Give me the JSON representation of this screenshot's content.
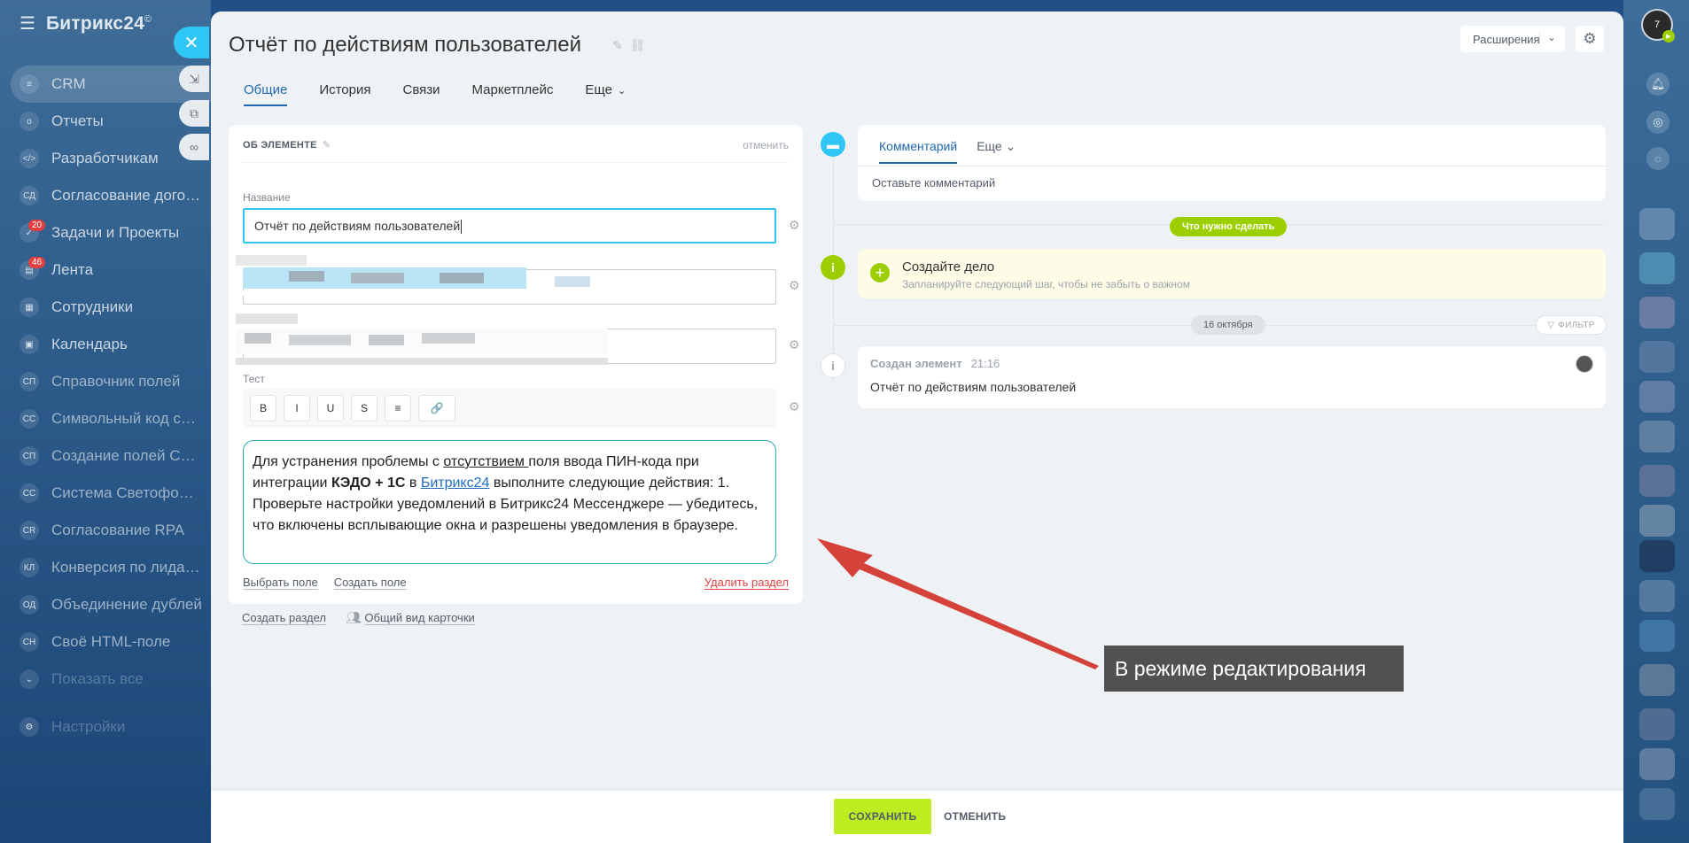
{
  "sidebar": {
    "brand": "Битрикс24",
    "brand_mark": "©",
    "items": [
      {
        "label": "CRM",
        "badge": ""
      },
      {
        "label": "Отчеты",
        "badge": ""
      },
      {
        "label": "Разработчикам",
        "badge": ""
      },
      {
        "label": "Согласование договора",
        "badge": ""
      },
      {
        "label": "Задачи и Проекты",
        "badge": "20"
      },
      {
        "label": "Лента",
        "badge": "46"
      },
      {
        "label": "Сотрудники",
        "badge": ""
      },
      {
        "label": "Календарь",
        "badge": ""
      },
      {
        "label": "Справочник полей",
        "badge": ""
      },
      {
        "label": "Символьный код спра...",
        "badge": ""
      },
      {
        "label": "Создание полей CRM",
        "badge": ""
      },
      {
        "label": "Система Светофор CRM",
        "badge": ""
      },
      {
        "label": "Согласование RPA",
        "badge": ""
      },
      {
        "label": "Конверсия по лидам ...",
        "badge": ""
      },
      {
        "label": "Объединение дублей",
        "badge": ""
      },
      {
        "label": "Своё HTML-поле",
        "badge": ""
      },
      {
        "label": "Показать все",
        "badge": ""
      },
      {
        "label": "Настройки",
        "badge": ""
      }
    ]
  },
  "header": {
    "title": "Отчёт по действиям пользователей",
    "extensions_label": "Расширения"
  },
  "tabs": [
    {
      "label": "Общие"
    },
    {
      "label": "История"
    },
    {
      "label": "Связи"
    },
    {
      "label": "Маркетплейс"
    },
    {
      "label": "Еще"
    }
  ],
  "card": {
    "section_title": "ОБ ЭЛЕМЕНТЕ",
    "cancel_label": "отменить",
    "name_label": "Название",
    "name_value": "Отчёт по действиям пользователей",
    "test_label": "Тест",
    "toolbar": [
      "B",
      "I",
      "U",
      "S",
      "≡",
      "🔗"
    ],
    "text": {
      "p1": "Для устранения проблемы с ",
      "p2": "отсутствием ",
      "p3": "поля ввода ПИН-кода при интеграции ",
      "p4": "КЭДО + 1С",
      "p5": " в ",
      "p6": "Битрикс24",
      "p7": " выполните следующие действия: 1. Проверьте настройки уведомлений в Битрикс24 Мессенджере — убедитесь, что включены всплывающие окна и разрешены уведомления в браузере."
    },
    "choose_field": "Выбрать поле",
    "create_field": "Создать поле",
    "delete_section": "Удалить раздел"
  },
  "below_card": {
    "create_section": "Создать раздел",
    "card_view": "Общий вид карточки"
  },
  "timeline": {
    "comment_tab": "Комментарий",
    "more_tab": "Еще",
    "comment_placeholder": "Оставьте комментарий",
    "todo_pill": "Что нужно сделать",
    "todo_title": "Создайте дело",
    "todo_sub": "Запланируйте следующий шаг, чтобы не забыть о важном",
    "date_pill": "16 октября",
    "filter_label": "ФИЛЬТР",
    "created_title": "Создан элемент",
    "created_time": "21:16",
    "created_text": "Отчёт по действиям пользователей"
  },
  "annotation": "В режиме редактирования",
  "footer": {
    "save": "СОХРАНИТЬ",
    "cancel": "ОТМЕНИТЬ"
  },
  "colors": {
    "accent": "#2067b0",
    "save_green": "#bbed21",
    "timeline_blue": "#2fc6f6",
    "timeline_green": "#9dcf00",
    "arrow_red": "#d4423a"
  }
}
